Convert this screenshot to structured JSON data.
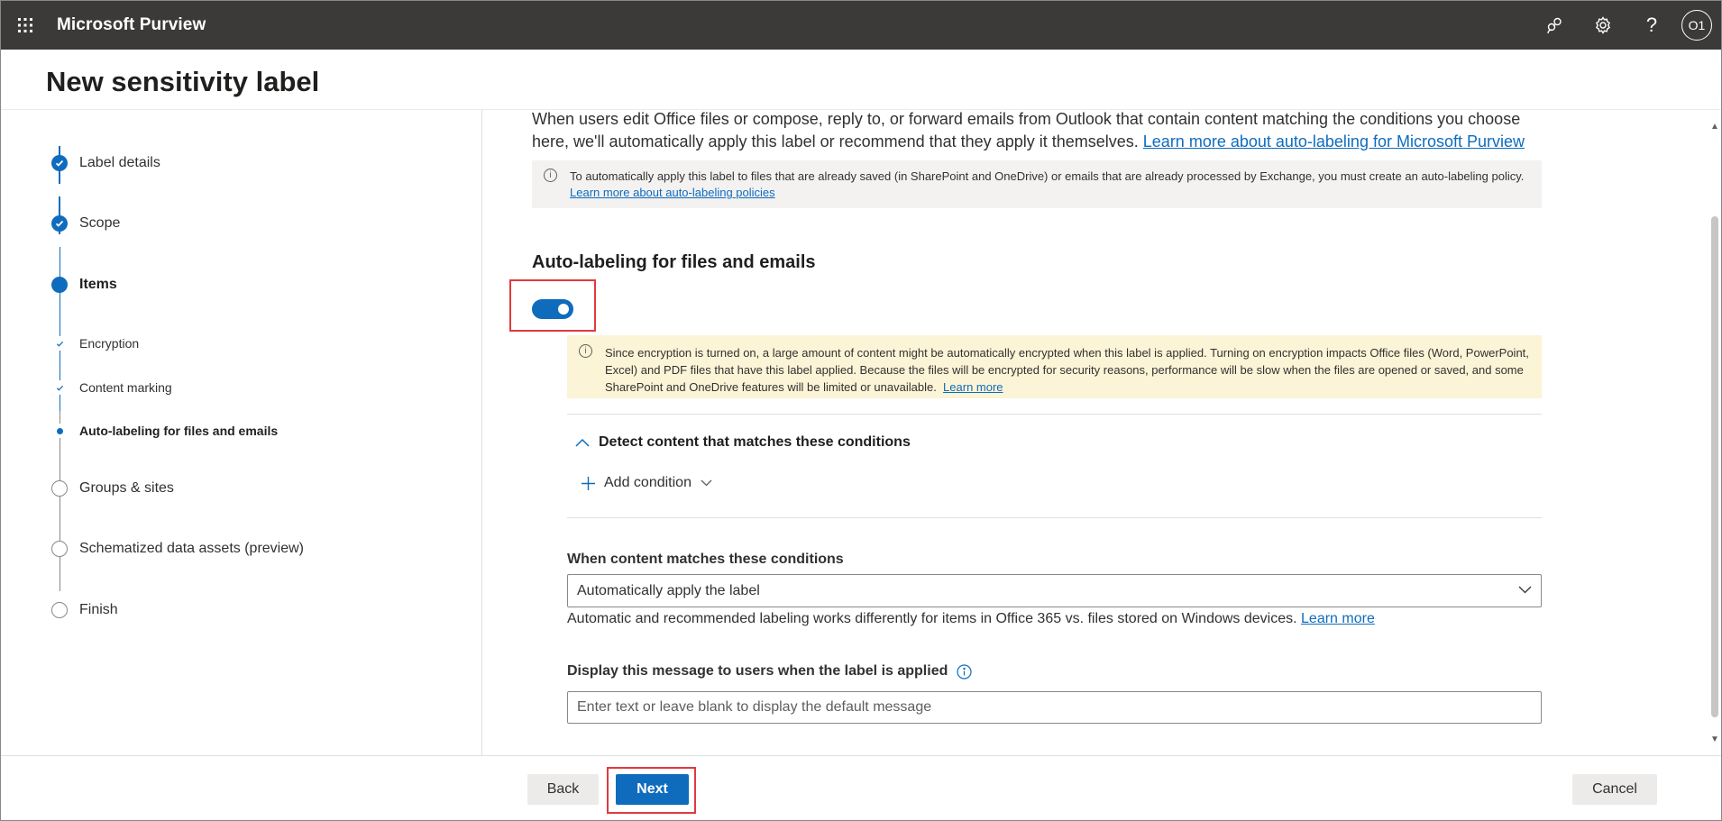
{
  "topbar": {
    "app_title": "Microsoft Purview",
    "avatar_initials": "O1",
    "help_label": "?"
  },
  "page": {
    "title": "New sensitivity label"
  },
  "steps": [
    {
      "label": "Label details",
      "state": "done"
    },
    {
      "label": "Scope",
      "state": "done"
    },
    {
      "label": "Items",
      "state": "current"
    },
    {
      "label": "Encryption",
      "state": "done",
      "sub": true
    },
    {
      "label": "Content marking",
      "state": "done",
      "sub": true
    },
    {
      "label": "Auto-labeling for files and emails",
      "state": "current",
      "sub": true
    },
    {
      "label": "Groups & sites",
      "state": "pending"
    },
    {
      "label": "Schematized data assets (preview)",
      "state": "pending"
    },
    {
      "label": "Finish",
      "state": "pending"
    }
  ],
  "main": {
    "intro_text": "When users edit Office files or compose, reply to, or forward emails from Outlook that contain content matching the conditions you choose here, we'll automatically apply this label or recommend that they apply it themselves.",
    "intro_link": "Learn more about auto-labeling for Microsoft Purview",
    "info_text": "To automatically apply this label to files that are already saved (in SharePoint and OneDrive) or emails that are already processed by Exchange, you must create an auto-labeling policy.",
    "info_link": "Learn more about auto-labeling policies",
    "section_title": "Auto-labeling for files and emails",
    "toggle_on": true,
    "warning_text": "Since encryption is turned on, a large amount of content might be automatically encrypted when this label is applied. Turning on encryption impacts Office files (Word, PowerPoint, Excel) and PDF files that have this label applied. Because the files will be encrypted for security reasons, performance will be slow when the files are opened or saved, and some SharePoint and OneDrive features will be limited or unavailable.",
    "warning_link": "Learn more",
    "detect_title": "Detect content that matches these conditions",
    "add_condition": "Add condition",
    "when_label": "When content matches these conditions",
    "when_value": "Automatically apply the label",
    "help_text": "Automatic and recommended labeling works differently for items in Office 365 vs. files stored on Windows devices.",
    "help_link": "Learn more",
    "message_label": "Display this message to users when the label is applied",
    "message_placeholder": "Enter text or leave blank to display the default message"
  },
  "footer": {
    "back_label": "Back",
    "next_label": "Next",
    "cancel_label": "Cancel"
  },
  "colors": {
    "topbar": "#3b3a39",
    "accent": "#0f6cbd",
    "highlight": "#e03a3e",
    "warning_bg": "#fcf4d6"
  }
}
